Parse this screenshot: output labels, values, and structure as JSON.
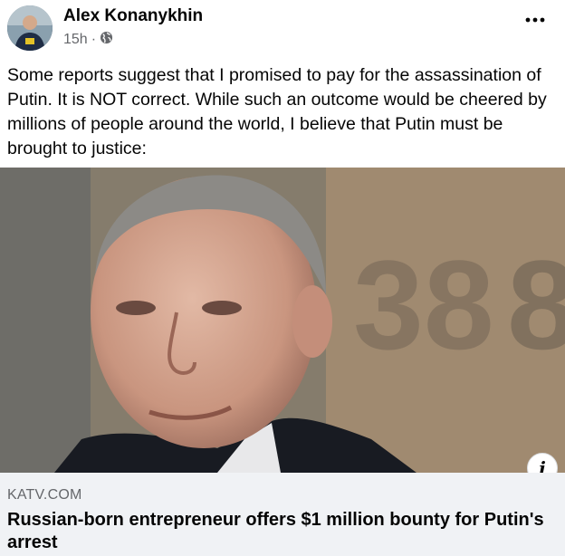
{
  "post": {
    "author": "Alex Konanykhin",
    "time": "15h",
    "separator": "·",
    "audience_icon": "globe-icon",
    "more_icon": "more-options-icon",
    "text": "Some reports suggest that I promised to pay for the assassination of Putin. It is NOT correct. While such an outcome would be cheered by millions of people around the world, I believe that Putin must be brought to justice:"
  },
  "link_preview": {
    "domain": "KATV.COM",
    "headline": "Russian-born entrepreneur offers $1 million bounty for Putin's arrest",
    "info_icon": "info-icon",
    "info_glyph": "i"
  },
  "colors": {
    "text": "#050505",
    "secondary_text": "#65676b",
    "link_box_bg": "#f0f2f5"
  }
}
